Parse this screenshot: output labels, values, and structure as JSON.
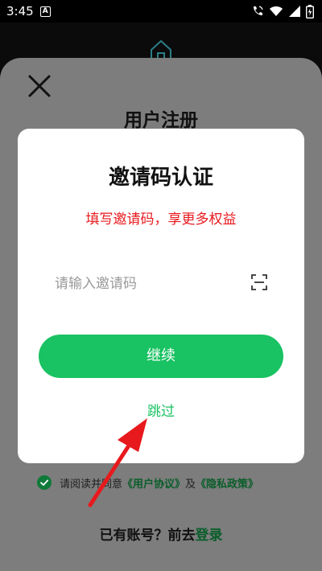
{
  "status_bar": {
    "time": "3:45",
    "notification_letter": "A"
  },
  "register": {
    "title": "用户注册",
    "agreement_prefix": "请阅读并同意",
    "user_agreement": "《用户协议》",
    "and": "及",
    "privacy_policy": "《隐私政策》",
    "have_account": "已有账号？前去",
    "login": "登录"
  },
  "modal": {
    "title": "邀请码认证",
    "subtitle": "填写邀请码，享更多权益",
    "input_placeholder": "请输入邀请码",
    "input_value": "",
    "continue_label": "继续",
    "skip_label": "跳过"
  },
  "colors": {
    "accent_green": "#19c262",
    "subtitle_red": "#e8191d",
    "annotation_arrow": "#e8191d"
  },
  "icons": [
    "close-icon",
    "scan-icon",
    "check-circle-icon",
    "wifi-icon",
    "signal-icon",
    "battery-icon",
    "call-icon"
  ]
}
